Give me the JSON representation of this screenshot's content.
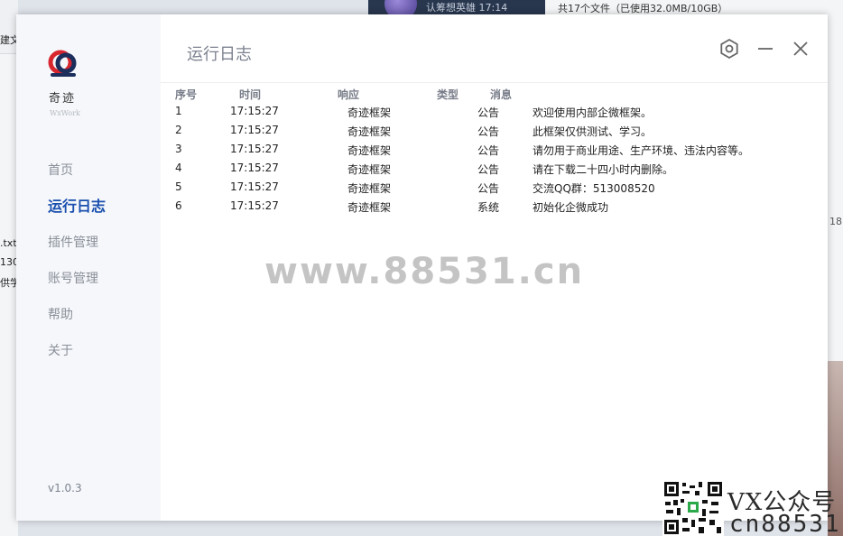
{
  "background": {
    "top_dark_text": "认筹想英雄   17:14",
    "top_right_text": "共17个文件（已使用32.0MB/10GB）",
    "left_fragments": [
      "建文",
      ".txt",
      "130",
      "供学"
    ],
    "right_fragment": "18"
  },
  "sidebar": {
    "logo_cn": "奇迹",
    "logo_en": "WxWork",
    "nav_items": [
      {
        "label": "首页",
        "active": false
      },
      {
        "label": "运行日志",
        "active": true
      },
      {
        "label": "插件管理",
        "active": false
      },
      {
        "label": "账号管理",
        "active": false
      },
      {
        "label": "帮助",
        "active": false
      },
      {
        "label": "关于",
        "active": false
      }
    ],
    "version": "v1.0.3"
  },
  "header": {
    "title": "运行日志",
    "icons": [
      "settings-icon",
      "minimize-icon",
      "close-icon"
    ]
  },
  "log": {
    "columns": [
      "序号",
      "时间",
      "响应",
      "类型",
      "消息"
    ],
    "rows": [
      {
        "idx": "1",
        "time": "17:15:27",
        "resp": "奇迹框架",
        "type": "公告",
        "msg": "欢迎使用内部企微框架。"
      },
      {
        "idx": "2",
        "time": "17:15:27",
        "resp": "奇迹框架",
        "type": "公告",
        "msg": "此框架仅供测试、学习。"
      },
      {
        "idx": "3",
        "time": "17:15:27",
        "resp": "奇迹框架",
        "type": "公告",
        "msg": "请勿用于商业用途、生产环境、违法内容等。"
      },
      {
        "idx": "4",
        "time": "17:15:27",
        "resp": "奇迹框架",
        "type": "公告",
        "msg": "请在下载二十四小时内删除。"
      },
      {
        "idx": "5",
        "time": "17:15:27",
        "resp": "奇迹框架",
        "type": "公告",
        "msg": "交流QQ群：513008520"
      },
      {
        "idx": "6",
        "time": "17:15:27",
        "resp": "奇迹框架",
        "type": "系统",
        "msg": "初始化企微成功"
      }
    ]
  },
  "watermark": "www.88531.cn",
  "overlay": {
    "vx_text": "VX公众号",
    "cn_text": "cn88531"
  },
  "colors": {
    "accent": "#1a4fae",
    "logo_red": "#d8262f",
    "logo_navy": "#1c2e5c"
  }
}
